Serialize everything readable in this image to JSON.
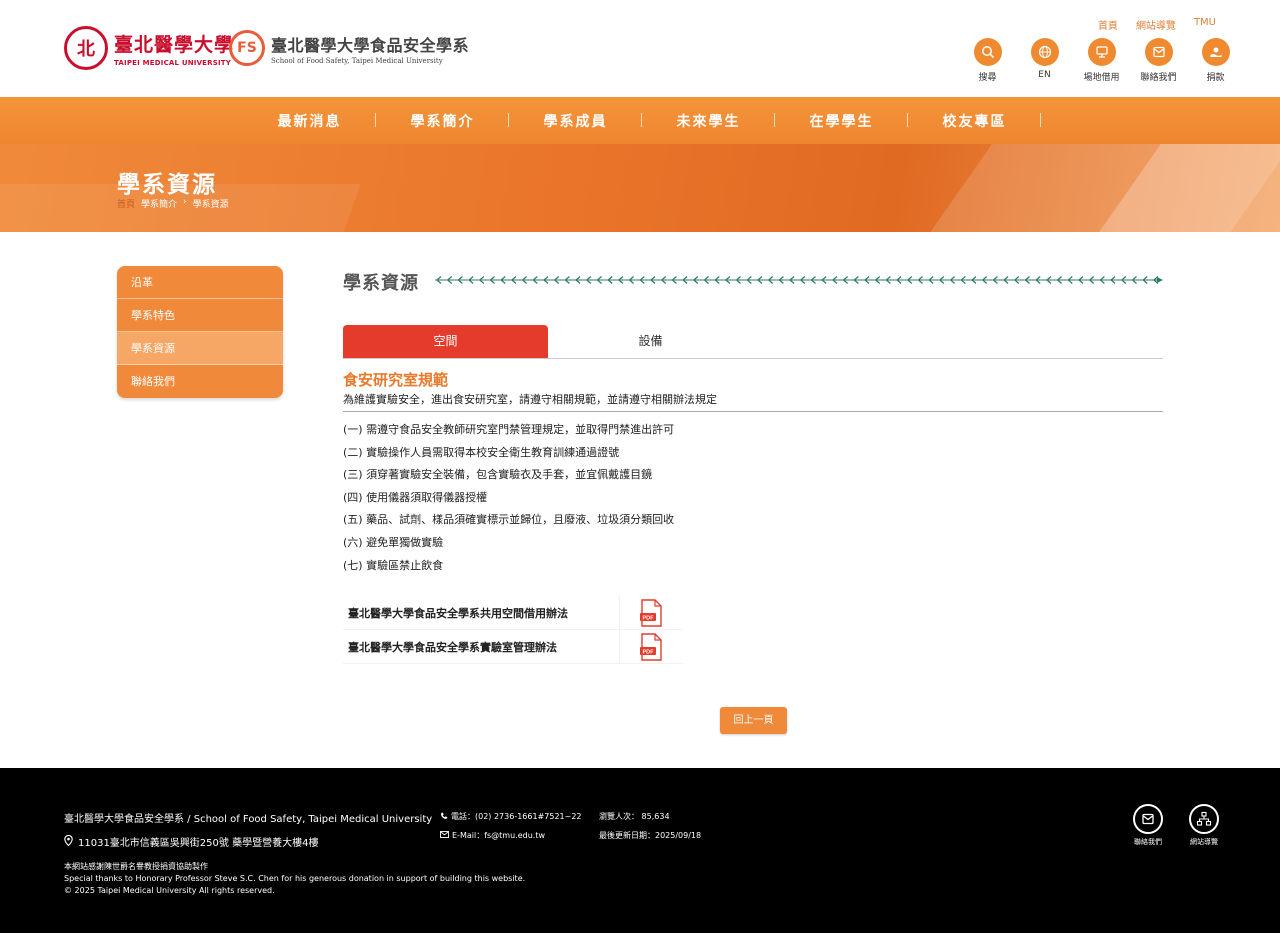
{
  "header": {
    "tmu_logo": {
      "zh": "臺北醫學大學",
      "en": "TAIPEI MEDICAL UNIVERSITY"
    },
    "fs_logo": {
      "zh": "臺北醫學大學食品安全學系",
      "en": "School of Food Safety, Taipei Medical University"
    },
    "toplinks": [
      "首頁",
      "網站導覽",
      "TMU"
    ],
    "tools": [
      {
        "label": "搜尋",
        "icon": "search-icon"
      },
      {
        "label": "EN",
        "icon": "globe-icon"
      },
      {
        "label": "場地借用",
        "icon": "venue-icon"
      },
      {
        "label": "聯絡我們",
        "icon": "mail-icon"
      },
      {
        "label": "捐款",
        "icon": "donate-icon"
      }
    ]
  },
  "nav": [
    "最新消息",
    "學系簡介",
    "學系成員",
    "未來學生",
    "在學學生",
    "校友專區"
  ],
  "banner": {
    "title": "學系資源",
    "breadcrumb": [
      "首頁",
      "學系簡介",
      "學系資源"
    ],
    "separator": "›"
  },
  "sidebar": [
    "沿革",
    "學系特色",
    "學系資源",
    "聯絡我們"
  ],
  "content": {
    "section_title": "學系資源",
    "tabs": [
      "空間",
      "設備"
    ],
    "heading": "食安研究室規範",
    "intro": "為維護實驗安全，進出食安研究室，請遵守相關規範，並請遵守相關辦法規定",
    "rules": [
      "(一) 需遵守食品安全教師研究室門禁管理規定，並取得門禁進出許可",
      "(二) 實驗操作人員需取得本校安全衛生教育訓練通過證號",
      "(三) 須穿著實驗安全裝備，包含實驗衣及手套，並宜佩戴護目鏡",
      "(四) 使用儀器須取得儀器授權",
      "(五) 藥品、試劑、樣品須確實標示並歸位，且廢液、垃圾須分類回收",
      "(六) 避免單獨做實驗",
      "(七) 實驗區禁止飲食"
    ],
    "files": [
      {
        "name": "臺北醫學大學食品安全學系共用空間借用辦法",
        "icon": "pdf-icon"
      },
      {
        "name": "臺北醫學大學食品安全學系實驗室管理辦法",
        "icon": "pdf-icon"
      }
    ],
    "back": "回上一頁"
  },
  "footer": {
    "name": "臺北醫學大學食品安全學系 / School of Food Safety, Taipei Medical University",
    "address": "11031臺北市信義區吳興街250號 藥學暨營養大樓4樓",
    "phone": "電話：(02) 2736-1661#7521~22",
    "email": "E-Mail：fs@tmu.edu.tw",
    "visits": "瀏覽人次： 85,634",
    "updated": "最後更新日期：2025/09/18",
    "credit": [
      "本網站感謝陳世爵名譽教授捐資協助製作",
      "Special thanks to Honorary Professor Steve S.C. Chen for his generous donation in support of building this website.",
      "© 2025 Taipei Medical University All rights reserved."
    ],
    "icons": [
      {
        "label": "聯絡我們",
        "icon": "mail-icon"
      },
      {
        "label": "網站導覽",
        "icon": "sitemap-icon"
      }
    ]
  },
  "colors": {
    "primary": "#f08a3a",
    "tab_active": "#e53b2c",
    "heading": "#e97a2c",
    "footer_bg": "#000000"
  }
}
